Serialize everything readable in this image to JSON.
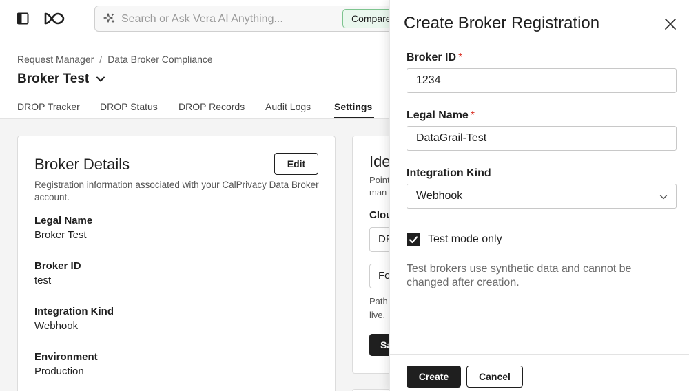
{
  "topbar": {
    "search_placeholder": "Search or Ask Vera AI Anything...",
    "compare_button": "Compare"
  },
  "breadcrumb": {
    "items": [
      "Request Manager",
      "Data Broker Compliance"
    ],
    "separator": "/"
  },
  "page": {
    "title": "Broker Test"
  },
  "tabs": [
    {
      "label": "DROP Tracker",
      "active": false
    },
    {
      "label": "DROP Status",
      "active": false
    },
    {
      "label": "DROP Records",
      "active": false
    },
    {
      "label": "Audit Logs",
      "active": false
    },
    {
      "label": "Settings",
      "active": true
    }
  ],
  "broker_card": {
    "title": "Broker Details",
    "edit_label": "Edit",
    "description": "Registration information associated with your CalPrivacy Data Broker account.",
    "fields": [
      {
        "label": "Legal Name",
        "value": "Broker Test"
      },
      {
        "label": "Broker ID",
        "value": "test"
      },
      {
        "label": "Integration Kind",
        "value": "Webhook"
      },
      {
        "label": "Environment",
        "value": "Production"
      }
    ]
  },
  "identity_card": {
    "title_fragment": "Ide",
    "desc_line1": "Point",
    "desc_line2": "man",
    "subheading": "Clou",
    "input1_value": "DR",
    "input2_value": "Fo",
    "path_line1": "Path",
    "path_line2": "live.",
    "save_fragment": "Sa"
  },
  "drawer": {
    "title": "Create Broker Registration",
    "broker_id": {
      "label": "Broker ID",
      "required_mark": "*",
      "value": "1234"
    },
    "legal_name": {
      "label": "Legal Name",
      "required_mark": "*",
      "value": "DataGrail-Test"
    },
    "integration_kind": {
      "label": "Integration Kind",
      "value": "Webhook"
    },
    "test_mode": {
      "label": "Test mode only",
      "checked": true
    },
    "help_text": "Test brokers use synthetic data and cannot be changed after creation.",
    "create_label": "Create",
    "cancel_label": "Cancel"
  },
  "colors": {
    "primary": "#1f1f1f",
    "required": "#d93025",
    "compare_border": "#7dc48f",
    "compare_bg": "#eaf7ee"
  }
}
